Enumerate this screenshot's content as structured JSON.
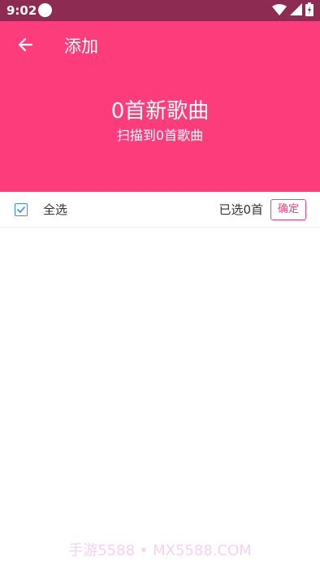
{
  "status_bar": {
    "time": "9:02",
    "icons": [
      "notification-dot-icon",
      "wifi-icon",
      "signal-icon",
      "battery-icon"
    ]
  },
  "header": {
    "title": "添加",
    "headline": "0首新歌曲",
    "subline": "扫描到0首歌曲",
    "background_color": "#fd3d7b"
  },
  "select_bar": {
    "select_all_label": "全选",
    "select_all_checked": true,
    "selected_count_text": "已选0首",
    "confirm_label": "确定"
  },
  "song_list": [],
  "watermark": "手游5588 • MX5588.COM",
  "colors": {
    "status_bar": "#8e2b52",
    "accent": "#fd3d7b",
    "checkbox": "#3a8ee6"
  }
}
